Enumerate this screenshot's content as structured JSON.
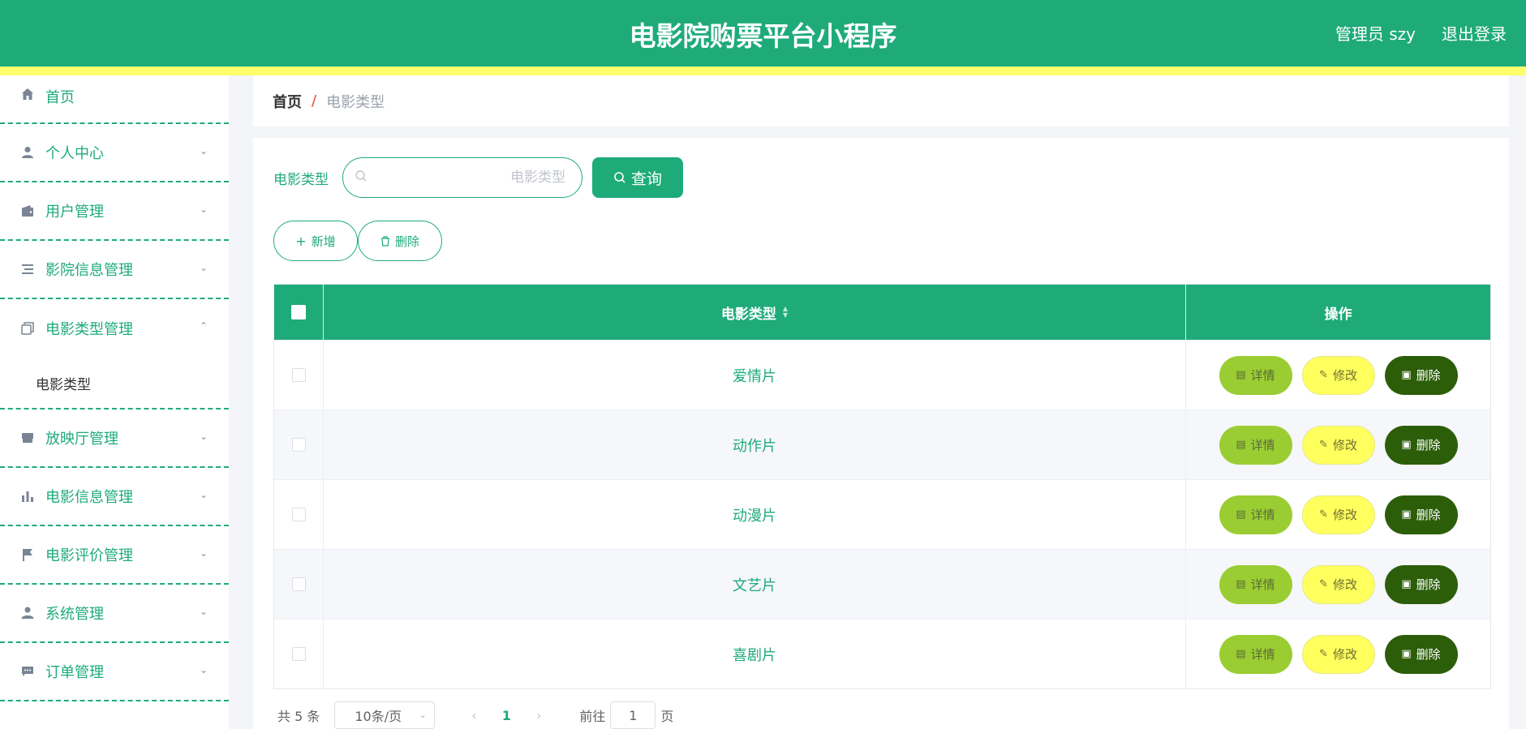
{
  "header": {
    "title": "电影院购票平台小程序",
    "admin": "管理员 szy",
    "logout": "退出登录"
  },
  "sidebar": {
    "items": [
      {
        "label": "首页",
        "icon": "home-icon"
      },
      {
        "label": "个人中心",
        "icon": "person-icon"
      },
      {
        "label": "用户管理",
        "icon": "wallet-icon"
      },
      {
        "label": "影院信息管理",
        "icon": "list-icon"
      },
      {
        "label": "电影类型管理",
        "icon": "copy-icon",
        "expanded": true
      },
      {
        "label": "放映厅管理",
        "icon": "store-icon"
      },
      {
        "label": "电影信息管理",
        "icon": "bar-chart-icon"
      },
      {
        "label": "电影评价管理",
        "icon": "flag-icon"
      },
      {
        "label": "系统管理",
        "icon": "user-admin-icon"
      },
      {
        "label": "订单管理",
        "icon": "message-icon"
      }
    ],
    "subitem": "电影类型"
  },
  "breadcrumb": {
    "home": "首页",
    "separator": "/",
    "current": "电影类型"
  },
  "search": {
    "label": "电影类型",
    "placeholder": "电影类型",
    "button": "查询"
  },
  "actions": {
    "add": "新增",
    "delete": "删除"
  },
  "table": {
    "columns": [
      "电影类型",
      "操作"
    ],
    "rows": [
      {
        "type": "爱情片"
      },
      {
        "type": "动作片"
      },
      {
        "type": "动漫片"
      },
      {
        "type": "文艺片"
      },
      {
        "type": "喜剧片"
      }
    ],
    "row_actions": {
      "detail": "详情",
      "edit": "修改",
      "delete": "删除"
    }
  },
  "pagination": {
    "total": "共 5 条",
    "page_size": "10条/页",
    "current_page": "1",
    "goto_label": "前往",
    "goto_value": "1",
    "page_suffix": "页"
  },
  "colors": {
    "primary": "#1eab79",
    "stripe": "#ffff6e",
    "detail": "#9acd32",
    "edit": "#ffff5e",
    "delete": "#2c5e0a"
  }
}
